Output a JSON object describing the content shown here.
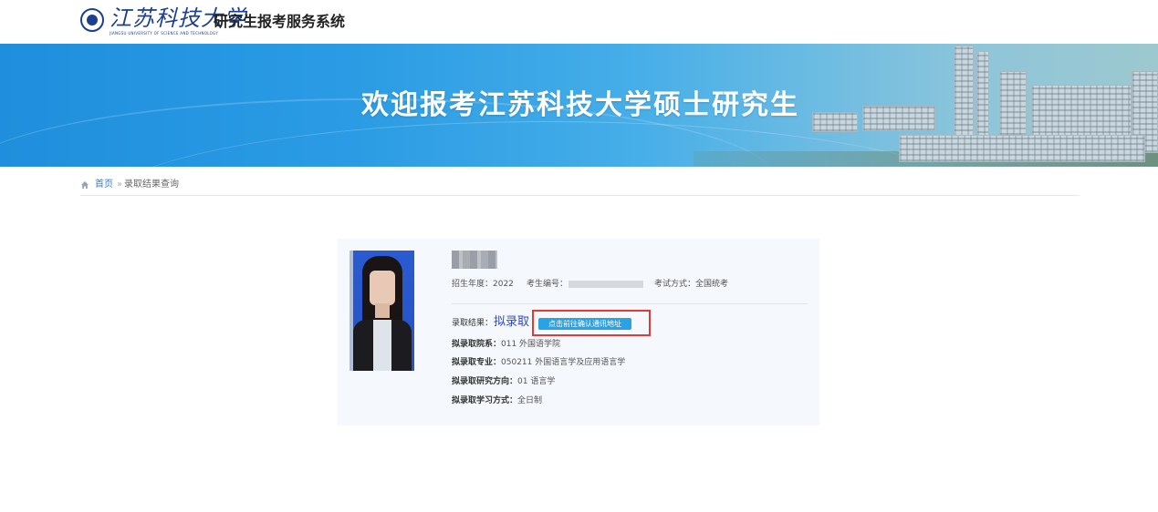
{
  "header": {
    "logo_script": "江苏科技大学",
    "logo_subtitle": "JIANGSU UNIVERSITY OF SCIENCE AND TECHNOLOGY",
    "system_title": "研究生报考服务系统"
  },
  "banner": {
    "title": "欢迎报考江苏科技大学硕士研究生"
  },
  "breadcrumb": {
    "home": "首页",
    "separator": "»",
    "current": "录取结果查询"
  },
  "candidate": {
    "year_label": "招生年度：2022",
    "exam_no_label": "考生编号：",
    "exam_mode_label": "考试方式：全国统考",
    "result_label": "录取结果：",
    "result_value": "拟录取",
    "confirm_button": "点击前往确认通讯地址",
    "details": [
      {
        "label": "拟录取院系：",
        "value": "011 外国语学院"
      },
      {
        "label": "拟录取专业：",
        "value": "050211 外国语言学及应用语言学"
      },
      {
        "label": "拟录取研究方向：",
        "value": "01 语言学"
      },
      {
        "label": "拟录取学习方式：",
        "value": "全日制"
      }
    ]
  },
  "colors": {
    "accent": "#29a2e6",
    "result_text": "#2c47d6",
    "highlight": "#e53935",
    "brand": "#1c3f8f"
  }
}
